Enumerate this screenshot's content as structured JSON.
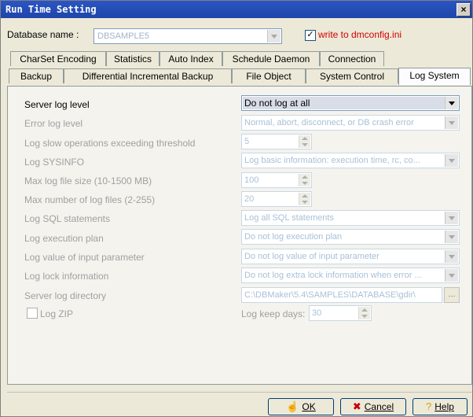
{
  "window": {
    "title": "Run Time Setting",
    "close_label": "×"
  },
  "database": {
    "label": "Database name :",
    "value": "DBSAMPLE5",
    "write_checked": "✓",
    "write_label": "write to dmconfig.ini"
  },
  "tabs_row1": [
    "CharSet Encoding",
    "Statistics",
    "Auto Index",
    "Schedule Daemon",
    "Connection"
  ],
  "tabs_row2": [
    "Backup",
    "Differential Incremental Backup",
    "File Object",
    "System Control",
    "Log System"
  ],
  "active_tab": "Log System",
  "settings": {
    "server_log_level": {
      "label": "Server log level",
      "value": "Do not log at all"
    },
    "error_log_level": {
      "label": "Error log level",
      "value": "Normal, abort, disconnect, or DB crash error"
    },
    "slow_ops": {
      "label": "Log slow operations exceeding threshold",
      "value": "5"
    },
    "sysinfo": {
      "label": "Log SYSINFO",
      "value": "Log basic information: execution time, rc, co..."
    },
    "max_file_size": {
      "label": "Max log file size (10-1500 MB)",
      "value": "100"
    },
    "max_files": {
      "label": "Max number of log files (2-255)",
      "value": "20"
    },
    "sql_statements": {
      "label": "Log SQL statements",
      "value": "Log all SQL statements"
    },
    "exec_plan": {
      "label": "Log execution plan",
      "value": "Do not log execution plan"
    },
    "input_param": {
      "label": "Log value of input parameter",
      "value": "Do not log value of input parameter"
    },
    "lock_info": {
      "label": "Log lock information",
      "value": "Do not log extra lock information when error ..."
    },
    "log_dir": {
      "label": "Server log directory",
      "value": "C:\\DBMaker\\5.4\\SAMPLES\\DATABASE\\gdir\\",
      "browse": "..."
    },
    "log_zip": {
      "label": "Log ZIP"
    },
    "keep_days": {
      "label": "Log keep days:",
      "value": "30"
    }
  },
  "buttons": {
    "ok": "OK",
    "cancel": "Cancel",
    "help": "Help"
  }
}
